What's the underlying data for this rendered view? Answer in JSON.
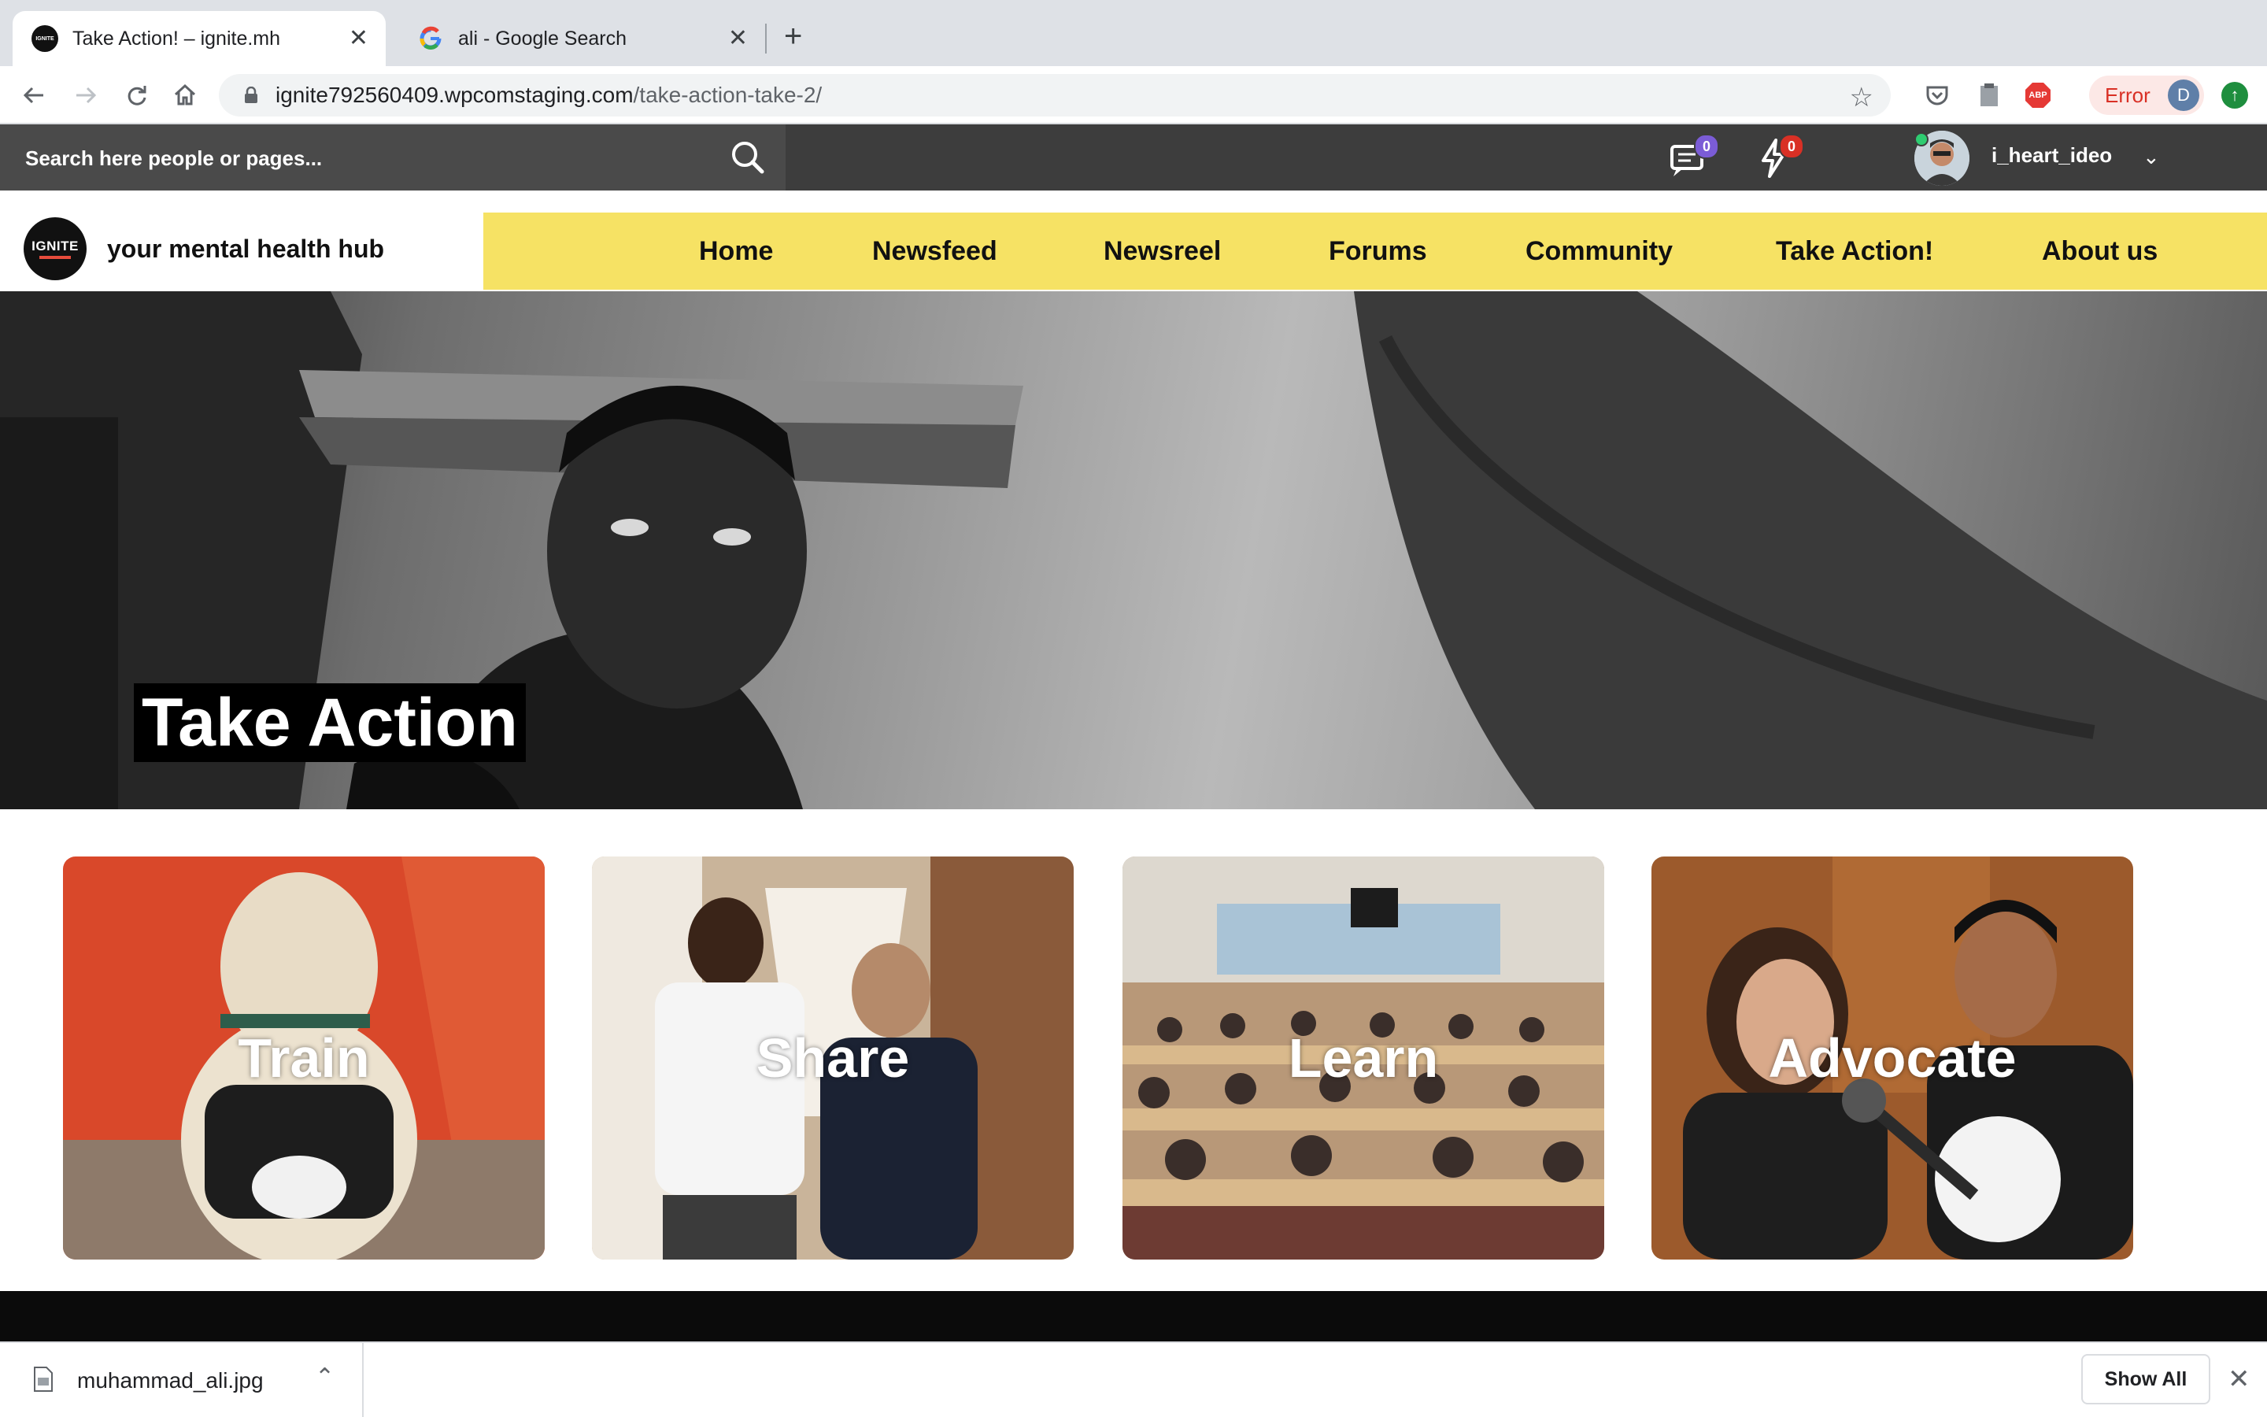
{
  "browser": {
    "tabs": [
      {
        "title": "Take Action! – ignite.mh",
        "favicon_text": "IGNITE",
        "active": true
      },
      {
        "title": "ali - Google Search",
        "active": false
      }
    ],
    "url_host": "ignite792560409.wpcomstaging.com",
    "url_path": "/take-action-take-2/",
    "extension_badges": {
      "adblock": "ABP"
    },
    "error_label": "Error",
    "profile_initial": "D"
  },
  "site": {
    "search_placeholder": "Search here people or pages...",
    "messages_count": "0",
    "notifications_count": "0",
    "username": "i_heart_ideo",
    "logo_text": "IGNITE",
    "tagline": "your mental health hub",
    "nav": [
      "Home",
      "Newsfeed",
      "Newsreel",
      "Forums",
      "Community",
      "Take Action!",
      "About us"
    ],
    "hero_title": "Take Action",
    "cards": [
      "Train",
      "Share",
      "Learn",
      "Advocate"
    ]
  },
  "downloads": {
    "file_name": "muhammad_ali.jpg",
    "show_all": "Show All"
  },
  "colors": {
    "nav_bg": "#f6e264",
    "site_bar": "#3d3d3d",
    "messages_badge": "#7b5cd6",
    "notifications_badge": "#d93025",
    "error_text": "#d93025"
  }
}
